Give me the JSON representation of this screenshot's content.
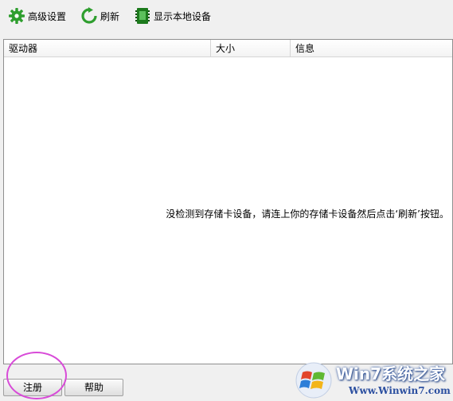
{
  "toolbar": {
    "advanced_settings": "高级设置",
    "refresh": "刷新",
    "show_local_devices": "显示本地设备"
  },
  "table": {
    "columns": [
      "驱动器",
      "大小",
      "信息"
    ],
    "empty_message": "没检测到存储卡设备，请连上你的存储卡设备然后点击‘刷新’按钮。"
  },
  "buttons": {
    "register": "注册",
    "help": "帮助"
  },
  "watermark": {
    "brand": "Win7系统之家",
    "url": "Www.Winwin7.com"
  },
  "colors": {
    "gear_icon": "#2e9e2e",
    "refresh_icon": "#2e9e2e",
    "device_icon": "#1c7a1c",
    "annotation_circle": "#d84bd8"
  }
}
